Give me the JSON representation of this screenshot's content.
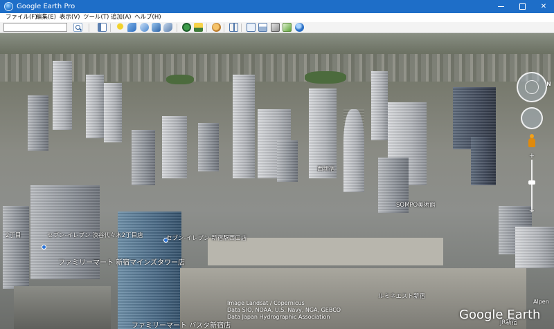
{
  "window": {
    "title": "Google Earth Pro",
    "buttons": {
      "minimize": "",
      "maximize": "",
      "close": "✕"
    }
  },
  "menu": {
    "items": [
      "ファイル(F)",
      "編集(E)",
      "表示(V)",
      "ツール(T)",
      "追加(A)",
      "ヘルプ(H)"
    ]
  },
  "toolbar": {
    "search_value": "",
    "icons": [
      "sidebar-icon",
      "placemark-icon",
      "polygon-icon",
      "path-icon",
      "overlay-icon",
      "record-tour-icon",
      "historical-imagery-icon",
      "sunlight-icon",
      "planets-icon",
      "ruler-icon",
      "email-icon",
      "print-icon",
      "save-image-icon",
      "google-maps-icon"
    ]
  },
  "map": {
    "labels": [
      "セブン-イレブン 渋谷代々木2丁目店",
      "セブン-イレブン 新宿駅西口店",
      "ファミリーマート 新宿マインズタワー店",
      "ファミリーマート バスタ新宿店",
      "ルミネエスト新宿",
      "SOMPO美術館",
      "西新宿",
      "JR新宿",
      "2丁目"
    ],
    "attribution": [
      "Image Landsat / Copernicus",
      "Data SIO, NOAA, U.S. Navy, NGA, GEBCO",
      "Data Japan Hydrographic Association"
    ],
    "logo": "Google Earth",
    "corner_text": "Alpen"
  },
  "navigation": {
    "north_letter": "N",
    "zoom_in": "+",
    "zoom_out": "−"
  },
  "colors": {
    "titlebar": "#1e6ec8",
    "toolbar": "#f3f3f3"
  }
}
